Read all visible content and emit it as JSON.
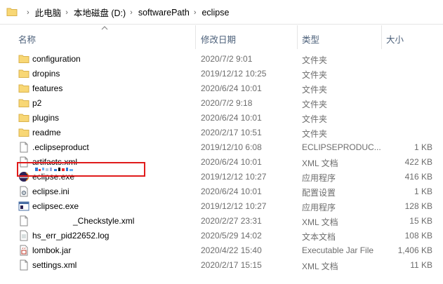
{
  "address": {
    "crumbs": [
      "此电脑",
      "本地磁盘 (D:)",
      "softwarePath",
      "eclipse"
    ]
  },
  "columns": {
    "name": "名称",
    "date": "修改日期",
    "type": "类型",
    "size": "大小"
  },
  "files": [
    {
      "name": "configuration",
      "date": "2020/7/2 9:01",
      "type": "文件夹",
      "size": "",
      "icon": "folder-icon"
    },
    {
      "name": "dropins",
      "date": "2019/12/12 10:25",
      "type": "文件夹",
      "size": "",
      "icon": "folder-icon"
    },
    {
      "name": "features",
      "date": "2020/6/24 10:01",
      "type": "文件夹",
      "size": "",
      "icon": "folder-icon"
    },
    {
      "name": "p2",
      "date": "2020/7/2 9:18",
      "type": "文件夹",
      "size": "",
      "icon": "folder-icon"
    },
    {
      "name": "plugins",
      "date": "2020/6/24 10:01",
      "type": "文件夹",
      "size": "",
      "icon": "folder-icon"
    },
    {
      "name": "readme",
      "date": "2020/2/17 10:51",
      "type": "文件夹",
      "size": "",
      "icon": "folder-icon"
    },
    {
      "name": ".eclipseproduct",
      "date": "2019/12/10 6:08",
      "type": "ECLIPSEPRODUC...",
      "size": "1 KB",
      "icon": "file-icon"
    },
    {
      "name": "artifacts.xml",
      "date": "2020/6/24 10:01",
      "type": "XML 文档",
      "size": "422 KB",
      "icon": "file-icon"
    },
    {
      "name": "eclipse.exe",
      "date": "2019/12/12 10:27",
      "type": "应用程序",
      "size": "416 KB",
      "icon": "eclipse-icon"
    },
    {
      "name": "eclipse.ini",
      "date": "2020/6/24 10:01",
      "type": "配置设置",
      "size": "1 KB",
      "icon": "settings-file-icon"
    },
    {
      "name": "eclipsec.exe",
      "date": "2019/12/12 10:27",
      "type": "应用程序",
      "size": "128 KB",
      "icon": "console-app-icon"
    },
    {
      "name": "_Checkstyle.xml",
      "date": "2020/2/27 23:31",
      "type": "XML 文档",
      "size": "15 KB",
      "icon": "file-icon"
    },
    {
      "name": "hs_err_pid22652.log",
      "date": "2020/5/29 14:02",
      "type": "文本文档",
      "size": "108 KB",
      "icon": "file-icon"
    },
    {
      "name": "lombok.jar",
      "date": "2020/4/22 15:40",
      "type": "Executable Jar File",
      "size": "1,406 KB",
      "icon": "jar-icon"
    },
    {
      "name": "settings.xml",
      "date": "2020/2/17 15:15",
      "type": "XML 文档",
      "size": "11 KB",
      "icon": "file-icon"
    }
  ],
  "colors": {
    "folder": "#f8d775",
    "header_text": "#4c607a",
    "highlight_border": "#e01b1b"
  }
}
